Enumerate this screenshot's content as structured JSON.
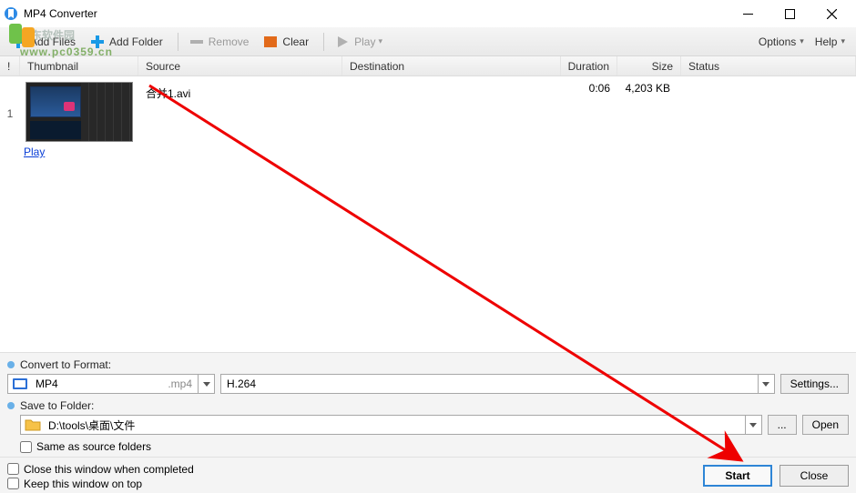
{
  "window": {
    "title": "MP4 Converter"
  },
  "watermark": {
    "text": "河东软件园",
    "url": "www.pc0359.cn"
  },
  "toolbar": {
    "add_files": "Add Files",
    "add_folder": "Add Folder",
    "remove": "Remove",
    "clear": "Clear",
    "play": "Play",
    "options": "Options",
    "help": "Help"
  },
  "columns": {
    "idx": "!",
    "thumbnail": "Thumbnail",
    "source": "Source",
    "destination": "Destination",
    "duration": "Duration",
    "size": "Size",
    "status": "Status"
  },
  "rows": [
    {
      "index": "1",
      "source": "合并1.avi",
      "play": "Play",
      "destination": "",
      "duration": "0:06",
      "size": "4,203 KB",
      "status": ""
    }
  ],
  "format": {
    "label": "Convert to Format:",
    "value": "MP4",
    "ext": ".mp4",
    "codec": "H.264",
    "settings": "Settings..."
  },
  "save": {
    "label": "Save to Folder:",
    "path": "D:\\tools\\桌面\\文件",
    "browse": "...",
    "open": "Open",
    "same_as_source": "Same as source folders"
  },
  "footer": {
    "close_when_completed": "Close this window when completed",
    "keep_on_top": "Keep this window on top",
    "start": "Start",
    "close": "Close"
  }
}
